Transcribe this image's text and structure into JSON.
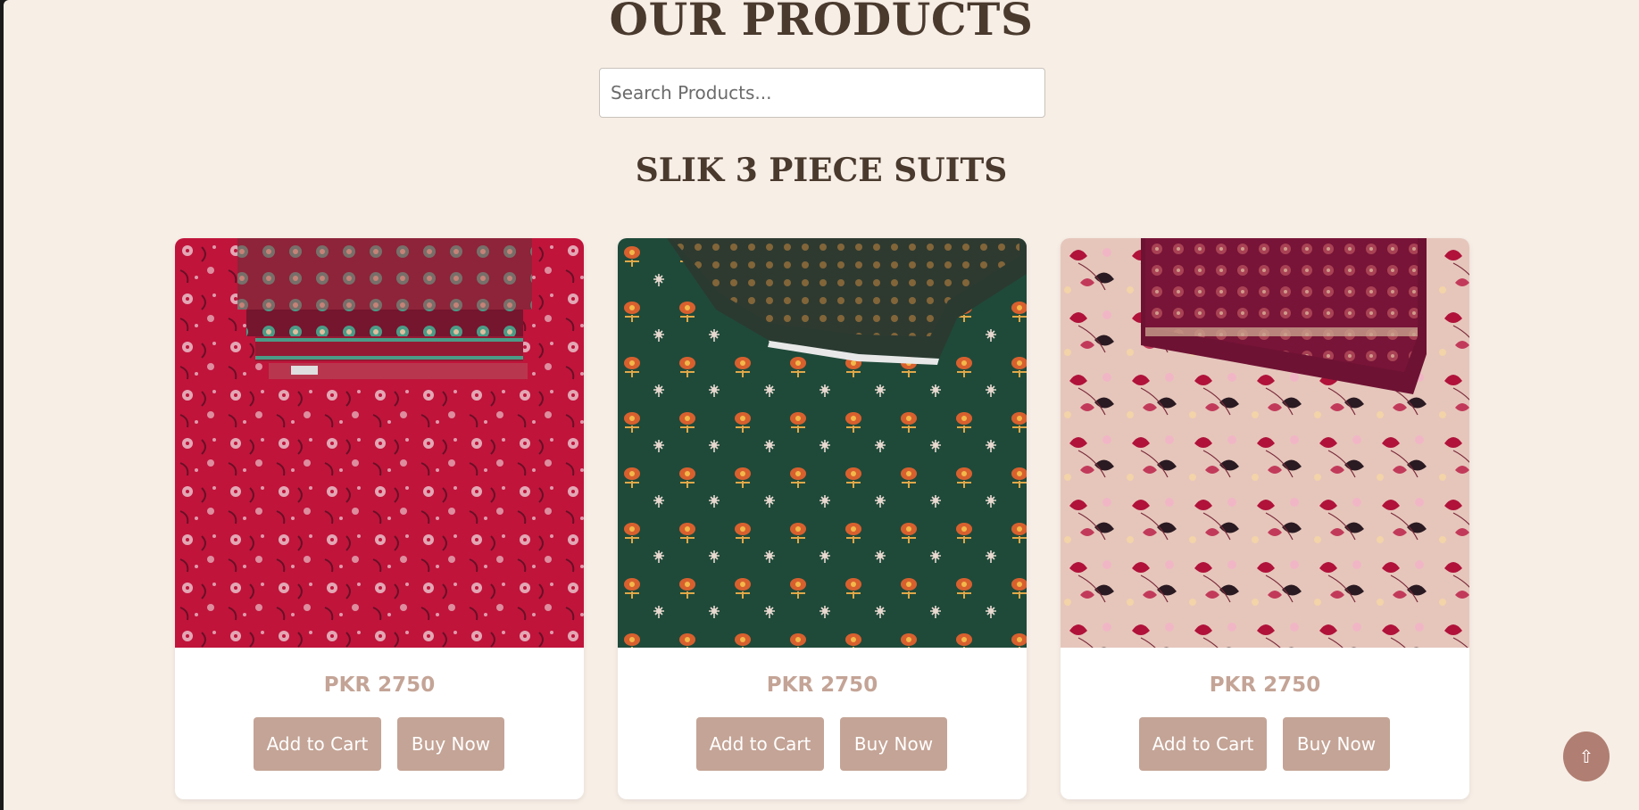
{
  "page": {
    "title": "OUR PRODUCTS"
  },
  "search": {
    "placeholder": "Search Products..."
  },
  "section": {
    "title": "SLIK 3 PIECE SUITS"
  },
  "products": [
    {
      "price": "PKR 2750",
      "add_to_cart_label": "Add to Cart",
      "buy_now_label": "Buy Now",
      "image_colors": {
        "base": "#c8153e",
        "accent": "#7a1630"
      }
    },
    {
      "price": "PKR 2750",
      "add_to_cart_label": "Add to Cart",
      "buy_now_label": "Buy Now",
      "image_colors": {
        "base": "#1f4a3a",
        "accent": "#d8602e"
      }
    },
    {
      "price": "PKR 2750",
      "add_to_cart_label": "Add to Cart",
      "buy_now_label": "Buy Now",
      "image_colors": {
        "base": "#e6c6bb",
        "accent": "#b0123a"
      }
    }
  ],
  "scroll_top": {
    "icon": "arrow-up-icon",
    "glyph": "⇧"
  },
  "colors": {
    "background": "#f7eee6",
    "heading": "#4a3a2e",
    "accent": "#c4a496",
    "scroll_button": "#b07e72"
  }
}
